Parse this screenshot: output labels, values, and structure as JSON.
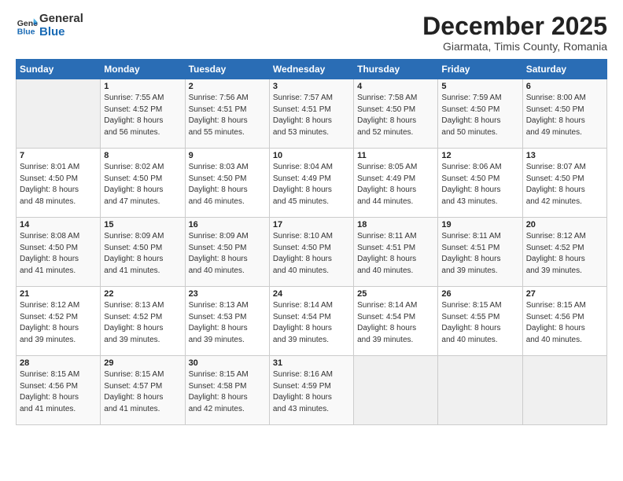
{
  "header": {
    "logo_general": "General",
    "logo_blue": "Blue",
    "title": "December 2025",
    "subtitle": "Giarmata, Timis County, Romania"
  },
  "days_of_week": [
    "Sunday",
    "Monday",
    "Tuesday",
    "Wednesday",
    "Thursday",
    "Friday",
    "Saturday"
  ],
  "weeks": [
    [
      {
        "day": "",
        "info": ""
      },
      {
        "day": "1",
        "info": "Sunrise: 7:55 AM\nSunset: 4:52 PM\nDaylight: 8 hours\nand 56 minutes."
      },
      {
        "day": "2",
        "info": "Sunrise: 7:56 AM\nSunset: 4:51 PM\nDaylight: 8 hours\nand 55 minutes."
      },
      {
        "day": "3",
        "info": "Sunrise: 7:57 AM\nSunset: 4:51 PM\nDaylight: 8 hours\nand 53 minutes."
      },
      {
        "day": "4",
        "info": "Sunrise: 7:58 AM\nSunset: 4:50 PM\nDaylight: 8 hours\nand 52 minutes."
      },
      {
        "day": "5",
        "info": "Sunrise: 7:59 AM\nSunset: 4:50 PM\nDaylight: 8 hours\nand 50 minutes."
      },
      {
        "day": "6",
        "info": "Sunrise: 8:00 AM\nSunset: 4:50 PM\nDaylight: 8 hours\nand 49 minutes."
      }
    ],
    [
      {
        "day": "7",
        "info": "Sunrise: 8:01 AM\nSunset: 4:50 PM\nDaylight: 8 hours\nand 48 minutes."
      },
      {
        "day": "8",
        "info": "Sunrise: 8:02 AM\nSunset: 4:50 PM\nDaylight: 8 hours\nand 47 minutes."
      },
      {
        "day": "9",
        "info": "Sunrise: 8:03 AM\nSunset: 4:50 PM\nDaylight: 8 hours\nand 46 minutes."
      },
      {
        "day": "10",
        "info": "Sunrise: 8:04 AM\nSunset: 4:49 PM\nDaylight: 8 hours\nand 45 minutes."
      },
      {
        "day": "11",
        "info": "Sunrise: 8:05 AM\nSunset: 4:49 PM\nDaylight: 8 hours\nand 44 minutes."
      },
      {
        "day": "12",
        "info": "Sunrise: 8:06 AM\nSunset: 4:50 PM\nDaylight: 8 hours\nand 43 minutes."
      },
      {
        "day": "13",
        "info": "Sunrise: 8:07 AM\nSunset: 4:50 PM\nDaylight: 8 hours\nand 42 minutes."
      }
    ],
    [
      {
        "day": "14",
        "info": "Sunrise: 8:08 AM\nSunset: 4:50 PM\nDaylight: 8 hours\nand 41 minutes."
      },
      {
        "day": "15",
        "info": "Sunrise: 8:09 AM\nSunset: 4:50 PM\nDaylight: 8 hours\nand 41 minutes."
      },
      {
        "day": "16",
        "info": "Sunrise: 8:09 AM\nSunset: 4:50 PM\nDaylight: 8 hours\nand 40 minutes."
      },
      {
        "day": "17",
        "info": "Sunrise: 8:10 AM\nSunset: 4:50 PM\nDaylight: 8 hours\nand 40 minutes."
      },
      {
        "day": "18",
        "info": "Sunrise: 8:11 AM\nSunset: 4:51 PM\nDaylight: 8 hours\nand 40 minutes."
      },
      {
        "day": "19",
        "info": "Sunrise: 8:11 AM\nSunset: 4:51 PM\nDaylight: 8 hours\nand 39 minutes."
      },
      {
        "day": "20",
        "info": "Sunrise: 8:12 AM\nSunset: 4:52 PM\nDaylight: 8 hours\nand 39 minutes."
      }
    ],
    [
      {
        "day": "21",
        "info": "Sunrise: 8:12 AM\nSunset: 4:52 PM\nDaylight: 8 hours\nand 39 minutes."
      },
      {
        "day": "22",
        "info": "Sunrise: 8:13 AM\nSunset: 4:52 PM\nDaylight: 8 hours\nand 39 minutes."
      },
      {
        "day": "23",
        "info": "Sunrise: 8:13 AM\nSunset: 4:53 PM\nDaylight: 8 hours\nand 39 minutes."
      },
      {
        "day": "24",
        "info": "Sunrise: 8:14 AM\nSunset: 4:54 PM\nDaylight: 8 hours\nand 39 minutes."
      },
      {
        "day": "25",
        "info": "Sunrise: 8:14 AM\nSunset: 4:54 PM\nDaylight: 8 hours\nand 39 minutes."
      },
      {
        "day": "26",
        "info": "Sunrise: 8:15 AM\nSunset: 4:55 PM\nDaylight: 8 hours\nand 40 minutes."
      },
      {
        "day": "27",
        "info": "Sunrise: 8:15 AM\nSunset: 4:56 PM\nDaylight: 8 hours\nand 40 minutes."
      }
    ],
    [
      {
        "day": "28",
        "info": "Sunrise: 8:15 AM\nSunset: 4:56 PM\nDaylight: 8 hours\nand 41 minutes."
      },
      {
        "day": "29",
        "info": "Sunrise: 8:15 AM\nSunset: 4:57 PM\nDaylight: 8 hours\nand 41 minutes."
      },
      {
        "day": "30",
        "info": "Sunrise: 8:15 AM\nSunset: 4:58 PM\nDaylight: 8 hours\nand 42 minutes."
      },
      {
        "day": "31",
        "info": "Sunrise: 8:16 AM\nSunset: 4:59 PM\nDaylight: 8 hours\nand 43 minutes."
      },
      {
        "day": "",
        "info": ""
      },
      {
        "day": "",
        "info": ""
      },
      {
        "day": "",
        "info": ""
      }
    ]
  ]
}
